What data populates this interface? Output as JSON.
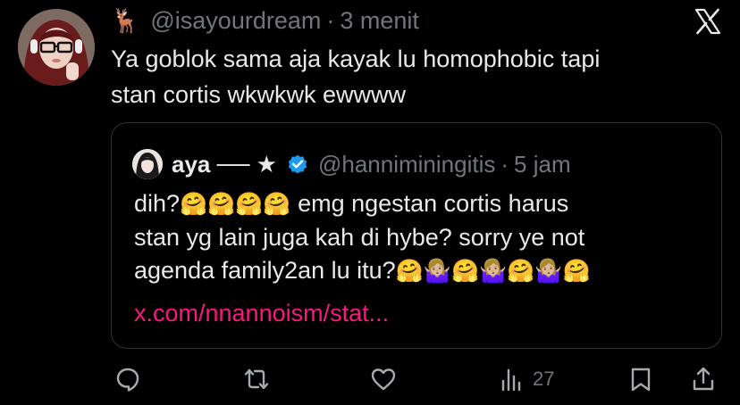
{
  "tweet": {
    "deer_emoji": "🦌",
    "handle": "@isayourdream",
    "time": "3 menit",
    "text_line1": "Ya goblok sama aja kayak lu homophobic tapi",
    "text_line2": "stan cortis wkwkwk ewwww"
  },
  "quote": {
    "name": "aya ── ★",
    "handle": "@hanniminingitis",
    "time": "5 jam",
    "line1_a": "dih?",
    "line1_emoji": "🤗🤗🤗🤗",
    "line1_b": " emg ngestan cortis harus",
    "line2": "stan yg lain juga kah di hybe? sorry ye not",
    "line3_a": "agenda family2an lu itu?",
    "line3_emoji": "🤗🤷🏼‍♀️🤗🤷🏼‍♀️🤗🤷🏼‍♀️🤗",
    "link": "x.com/nnannoism/stat..."
  },
  "actions": {
    "views": "27"
  },
  "colors": {
    "background": "#000000",
    "text": "#e7e9ea",
    "muted": "#71767b",
    "link": "#f91880",
    "verified": "#1d9bf0",
    "border": "#2f3336"
  }
}
